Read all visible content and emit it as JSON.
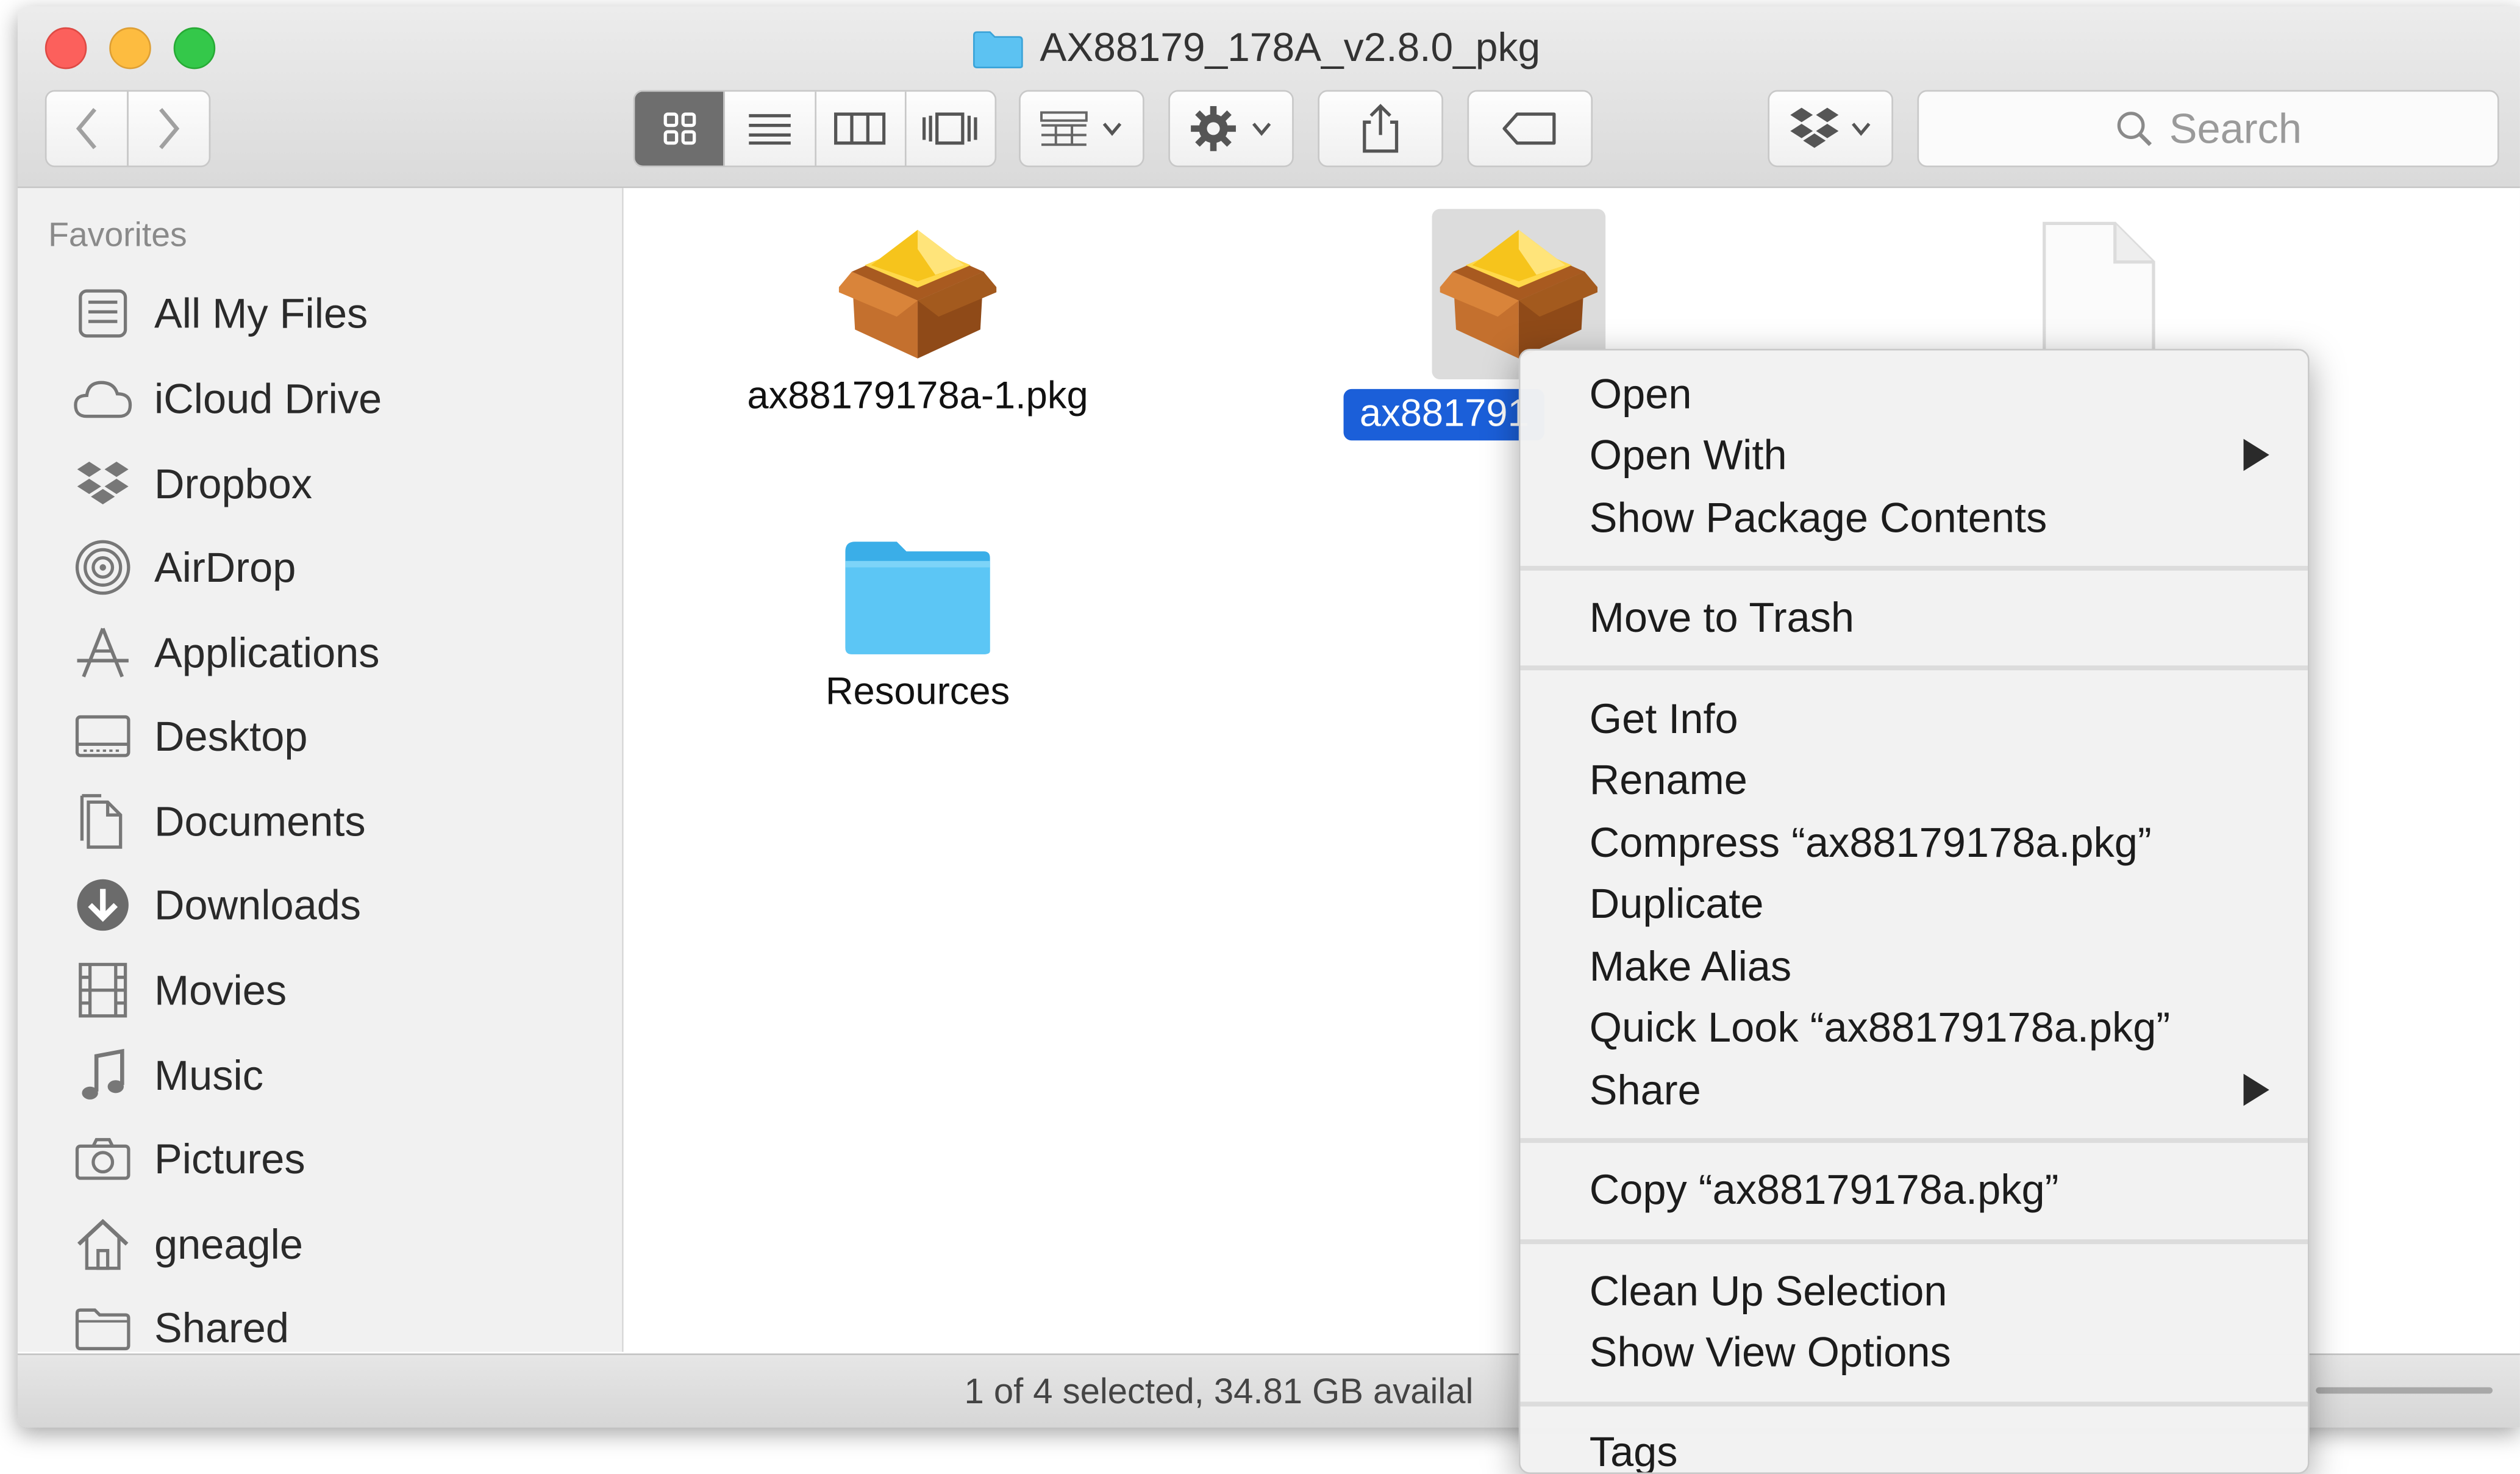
{
  "window": {
    "title": "AX88179_178A_v2.8.0_pkg",
    "colors": {
      "close": "#fc605c",
      "minimize": "#fdbc40",
      "maximize": "#34c84a",
      "selection": "#1b5fd9",
      "folder": "#40b8f0"
    }
  },
  "toolbar": {
    "back_icon": "chevron-left-icon",
    "forward_icon": "chevron-right-icon",
    "view_modes": [
      "icon-view-icon",
      "list-view-icon",
      "column-view-icon",
      "cover-flow-icon"
    ],
    "arrange_icon": "arrange-grid-icon",
    "action_icon": "gear-icon",
    "share_icon": "share-icon",
    "tags_icon": "tag-icon",
    "dropbox_icon": "dropbox-icon",
    "search_placeholder": "Search"
  },
  "sidebar": {
    "heading": "Favorites",
    "items": [
      {
        "label": "All My Files",
        "icon": "all-files-icon"
      },
      {
        "label": "iCloud Drive",
        "icon": "cloud-icon"
      },
      {
        "label": "Dropbox",
        "icon": "dropbox-icon"
      },
      {
        "label": "AirDrop",
        "icon": "airdrop-icon"
      },
      {
        "label": "Applications",
        "icon": "applications-icon"
      },
      {
        "label": "Desktop",
        "icon": "desktop-icon"
      },
      {
        "label": "Documents",
        "icon": "documents-icon"
      },
      {
        "label": "Downloads",
        "icon": "downloads-icon"
      },
      {
        "label": "Movies",
        "icon": "film-icon"
      },
      {
        "label": "Music",
        "icon": "music-note-icon"
      },
      {
        "label": "Pictures",
        "icon": "camera-icon"
      },
      {
        "label": "gneagle",
        "icon": "home-icon"
      },
      {
        "label": "Shared",
        "icon": "shared-folder-icon"
      }
    ]
  },
  "files": [
    {
      "name": "ax88179178a-1.pkg",
      "icon": "package-icon"
    },
    {
      "name": "ax881791",
      "icon": "package-icon"
    },
    {
      "name": "Resources",
      "icon": "folder-icon"
    }
  ],
  "status": "1 of 4 selected, 34.81 GB availal",
  "context_menu": {
    "groups": [
      [
        "Open",
        "Open With",
        "Show Package Contents"
      ],
      [
        "Move to Trash"
      ],
      [
        "Get Info",
        "Rename",
        "Compress “ax88179178a.pkg”",
        "Duplicate",
        "Make Alias",
        "Quick Look “ax88179178a.pkg”",
        "Share"
      ],
      [
        "Copy “ax88179178a.pkg”"
      ],
      [
        "Clean Up Selection",
        "Show View Options"
      ],
      [
        "Tags"
      ]
    ]
  }
}
